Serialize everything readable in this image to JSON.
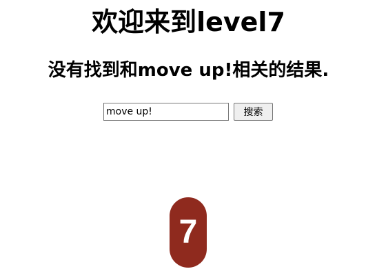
{
  "page": {
    "heading": "欢迎来到level7",
    "result_message": "没有找到和move up!相关的结果."
  },
  "search": {
    "input_value": "move up!",
    "button_label": "搜索"
  },
  "badge": {
    "number": "7",
    "icon": "level-7-badge-icon",
    "color": "#8f2a1e",
    "text_color": "#ffffff"
  }
}
